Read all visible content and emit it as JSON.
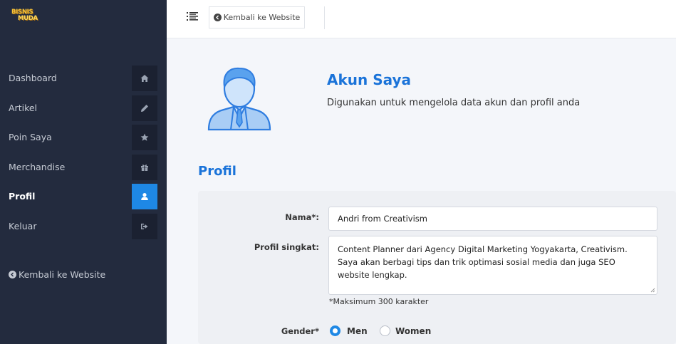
{
  "brand": {
    "line1": "BISNIS",
    "line2": "MUDA"
  },
  "sidebar": {
    "items": [
      {
        "label": "Dashboard",
        "icon": "home-icon"
      },
      {
        "label": "Artikel",
        "icon": "pencil-icon"
      },
      {
        "label": "Poin Saya",
        "icon": "star-icon"
      },
      {
        "label": "Merchandise",
        "icon": "gift-icon"
      },
      {
        "label": "Profil",
        "icon": "user-icon",
        "active": true
      },
      {
        "label": "Keluar",
        "icon": "sign-out-icon"
      }
    ],
    "back_label": "Kembali ke Website"
  },
  "topbar": {
    "back_label": "Kembali ke Website"
  },
  "header": {
    "title": "Akun Saya",
    "subtitle": "Digunakan untuk mengelola data akun dan profil anda"
  },
  "profile": {
    "section_title": "Profil",
    "name_label": "Nama*:",
    "name_value": "Andri from Creativism",
    "bio_label": "Profil singkat:",
    "bio_value": "Content Planner dari Agency Digital Marketing Yogyakarta, Creativism. Saya akan berbagi tips dan trik optimasi sosial media dan juga SEO website lengkap.",
    "bio_hint": "*Maksimum 300 karakter",
    "gender_label": "Gender*",
    "gender_options": [
      "Men",
      "Women"
    ],
    "gender_selected": "Men"
  },
  "colors": {
    "sidebar_bg": "#232b3e",
    "accent": "#1e88e5",
    "title_blue": "#1a73d9"
  }
}
